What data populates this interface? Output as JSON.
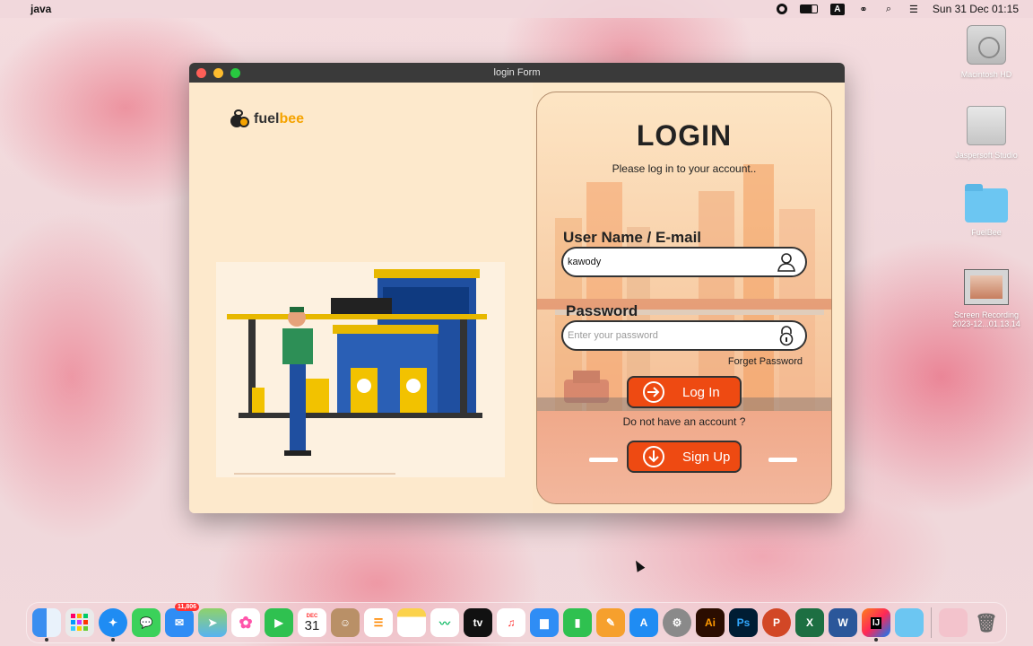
{
  "menubar": {
    "app_name": "java",
    "datetime": "Sun 31 Dec  01:15",
    "input_badge": "A"
  },
  "desktop": {
    "icons": [
      {
        "label": "Macintosh HD"
      },
      {
        "label": "Jaspersoft Studio"
      },
      {
        "label": "FuelBee"
      },
      {
        "label": "Screen Recording\n2023-12...01.13.14"
      }
    ]
  },
  "window": {
    "title": "login Form",
    "logo": {
      "text_main": "fuel",
      "text_accent": "bee"
    },
    "login": {
      "title": "LOGIN",
      "subtitle": "Please log in to your account..",
      "username_label": "User Name / E-mail",
      "username_value": "kawody",
      "password_label": "Password",
      "password_placeholder": "Enter your password",
      "forget_label": "Forget Password",
      "login_button": "Log In",
      "no_account_text": "Do not have an account ?",
      "signup_button": "Sign Up"
    }
  },
  "dock": {
    "calendar_month": "DEC",
    "calendar_day": "31",
    "mail_badge": "11,806",
    "apps": [
      "Finder",
      "Launchpad",
      "Safari",
      "Messages",
      "Mail",
      "Maps",
      "Photos",
      "FaceTime",
      "Calendar",
      "Contacts",
      "Reminders",
      "Notes",
      "Freeform",
      "TV",
      "Music",
      "Keynote",
      "Numbers",
      "Pages",
      "App Store",
      "System Settings",
      "Illustrator",
      "Photoshop",
      "PowerPoint",
      "Excel",
      "Word",
      "IntelliJ IDEA",
      "Folder",
      "Downloads",
      "Trash"
    ],
    "ai_label": "Ai",
    "ps_label": "Ps",
    "tv_label": "tv",
    "ij_label": "IJ"
  },
  "colors": {
    "accent": "#ee4a12",
    "window_bg": "#fde8c9",
    "logo_accent": "#f5a300"
  }
}
